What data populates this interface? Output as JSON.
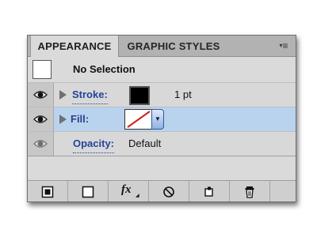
{
  "tabs": [
    {
      "label": "APPEARANCE"
    },
    {
      "label": "GRAPHIC STYLES"
    }
  ],
  "panel_menu": {
    "icon": "panel-menu-icon"
  },
  "selection": {
    "label": "No Selection"
  },
  "attributes": {
    "stroke": {
      "label": "Stroke:",
      "color": "#000000",
      "value": "1 pt"
    },
    "fill": {
      "label": "Fill:",
      "value": "none"
    },
    "opacity": {
      "label": "Opacity:",
      "value": "Default"
    }
  },
  "toolbar": {
    "fx_label": "fx",
    "icons": [
      "add-stroke-icon",
      "add-fill-icon",
      "fx-icon",
      "clear-appearance-icon",
      "duplicate-item-icon",
      "delete-icon"
    ]
  },
  "colors": {
    "panel_bg": "#dadada",
    "selected_row": "#b9d3ef",
    "link": "#24449c"
  }
}
